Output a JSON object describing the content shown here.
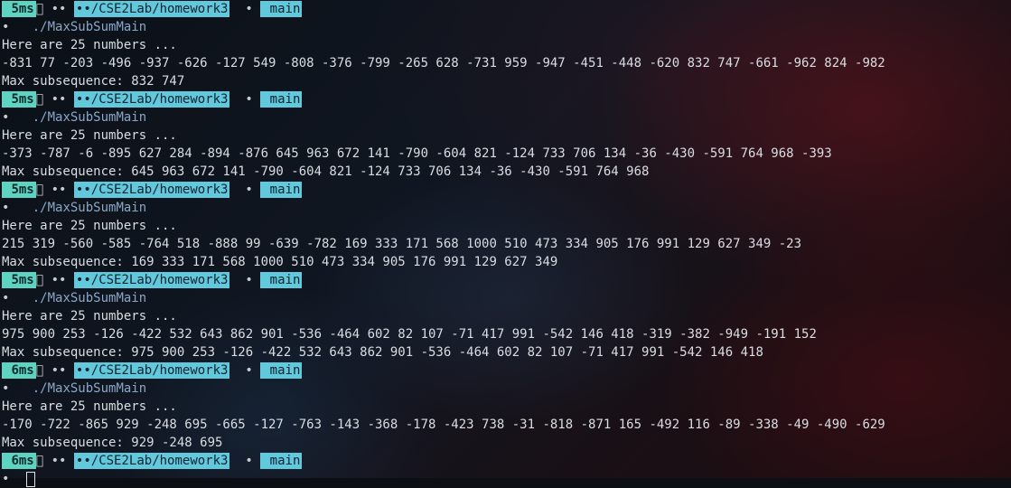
{
  "prompt": {
    "left_glyph": "",
    "time_icon_glyph": "",
    "dots": "••",
    "folder_glyph": "",
    "path": "••/CSE2Lab/homework3",
    "sep_glyph": "",
    "middot": "•",
    "git_glyph": "",
    "branch": "main",
    "end_glyph": "",
    "cmd_prefix": "•",
    "cmd_glyph_a": "",
    "cmd_glyph_b": "",
    "command": "./MaxSubSumMain"
  },
  "runs": [
    {
      "time": "5ms",
      "header": "Here are 25 numbers ...",
      "numbers": "-831 77 -203 -496 -937 -626 -127 549 -808 -376 -799 -265 628 -731 959 -947 -451 -448 -620 832 747 -661 -962 824 -982",
      "result": "Max subsequence: 832 747"
    },
    {
      "time": "5ms",
      "header": "Here are 25 numbers ...",
      "numbers": "-373 -787 -6 -895 627 284 -894 -876 645 963 672 141 -790 -604 821 -124 733 706 134 -36 -430 -591 764 968 -393",
      "result": "Max subsequence: 645 963 672 141 -790 -604 821 -124 733 706 134 -36 -430 -591 764 968"
    },
    {
      "time": "5ms",
      "header": "Here are 25 numbers ...",
      "numbers": "215 319 -560 -585 -764 518 -888 99 -639 -782 169 333 171 568 1000 510 473 334 905 176 991 129 627 349 -23",
      "result": "Max subsequence: 169 333 171 568 1000 510 473 334 905 176 991 129 627 349"
    },
    {
      "time": "5ms",
      "header": "Here are 25 numbers ...",
      "numbers": "975 900 253 -126 -422 532 643 862 901 -536 -464 602 82 107 -71 417 991 -542 146 418 -319 -382 -949 -191 152",
      "result": "Max subsequence: 975 900 253 -126 -422 532 643 862 901 -536 -464 602 82 107 -71 417 991 -542 146 418"
    },
    {
      "time": "6ms",
      "header": "Here are 25 numbers ...",
      "numbers": "-170 -722 -865 929 -248 695 -665 -127 -763 -143 -368 -178 -423 738 -31 -818 -871 165 -492 116 -89 -338 -49 -490 -629",
      "result": "Max subsequence: 929 -248 695"
    }
  ],
  "final_prompt": {
    "time": "6ms",
    "input_glyphs": "•  "
  }
}
